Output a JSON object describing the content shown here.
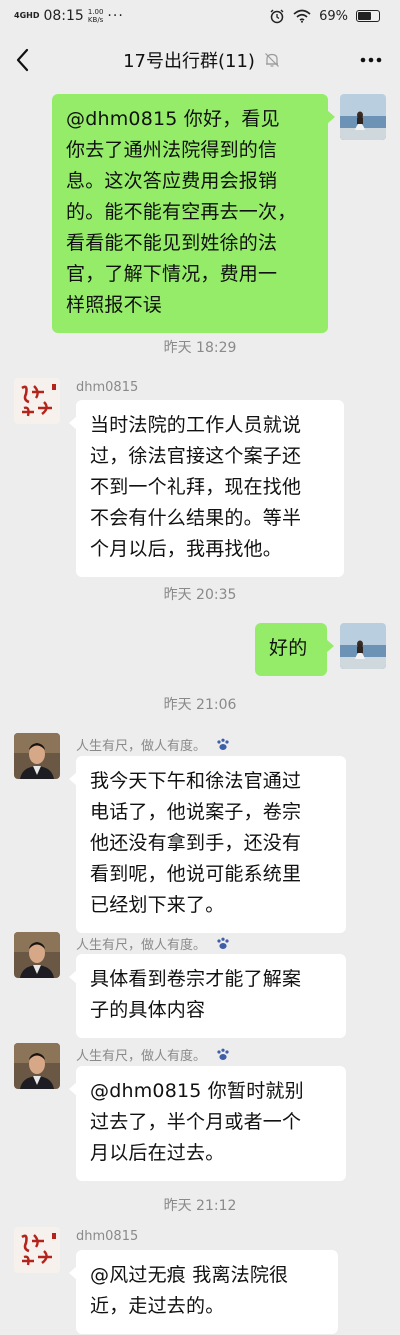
{
  "status_bar": {
    "network": "4GHD",
    "time": "08:15",
    "speed_value": "1.00",
    "speed_unit": "KB/s",
    "more": "···",
    "battery": "69%",
    "battery_level": 0.69
  },
  "header": {
    "title": "17号出行群(11)",
    "back_icon": "chevron-left-icon",
    "mute_icon": "bell-off-icon",
    "more_icon": "more-dots-icon"
  },
  "messages": [
    {
      "side": "right",
      "lines": [
        "@dhm0815 你好，看见",
        "你去了通州法院得到的信",
        "息。这次答应费用会报销",
        "的。能不能有空再去一次，",
        "看看能不能见到姓徐的法",
        "官，了解下情况，费用一",
        "样照报不误"
      ]
    },
    {
      "timestamp": "昨天 18:29"
    },
    {
      "side": "left",
      "sender": "dhm0815",
      "lines": [
        "当时法院的工作人员就说",
        "过，徐法官接这个案子还",
        "不到一个礼拜，现在找他",
        "不会有什么结果的。等半",
        "个月以后，我再找他。"
      ]
    },
    {
      "timestamp": "昨天 20:35"
    },
    {
      "side": "right",
      "lines": [
        "好的"
      ]
    },
    {
      "timestamp": "昨天 21:06"
    },
    {
      "side": "left",
      "sender": "人生有尺，做人有度。",
      "lines": [
        "我今天下午和徐法官通过",
        "电话了，他说案子，卷宗",
        "他还没有拿到手，还没有",
        "看到呢，他说可能系统里",
        "已经划下来了。"
      ]
    },
    {
      "side": "left",
      "sender": "人生有尺，做人有度。",
      "lines": [
        "具体看到卷宗才能了解案",
        "子的具体内容"
      ]
    },
    {
      "side": "left",
      "sender": "人生有尺，做人有度。",
      "lines": [
        "@dhm0815 你暂时就别",
        "过去了，半个月或者一个",
        "月以后在过去。"
      ]
    },
    {
      "timestamp": "昨天 21:12"
    },
    {
      "side": "left",
      "sender": "dhm0815",
      "lines": [
        "@风过无痕  我离法院很",
        "近，走过去的。"
      ]
    }
  ],
  "avatars": {
    "self_icon": "self-avatar-icon",
    "dhm_icon": "calligraphy-avatar-icon",
    "renshen_icon": "man-portrait-avatar-icon",
    "badge_icon": "paw-badge-icon"
  }
}
